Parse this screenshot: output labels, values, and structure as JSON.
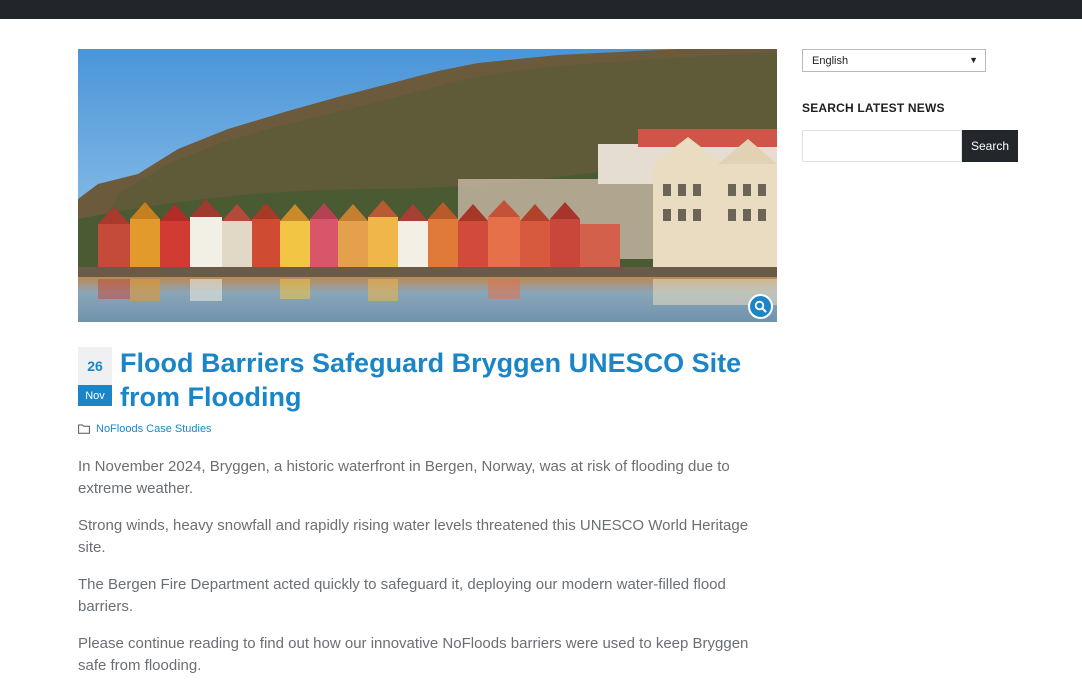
{
  "post": {
    "day": "26",
    "month": "Nov",
    "title": "Flood Barriers Safeguard Bryggen UNESCO Site from Flooding",
    "category": "NoFloods Case Studies",
    "paragraphs": [
      "In November 2024, Bryggen, a historic waterfront in Bergen, Norway, was at risk of flooding due to extreme weather.",
      "Strong winds, heavy snowfall and rapidly rising water levels threatened this UNESCO World Heritage site.",
      "The Bergen Fire Department acted quickly to safeguard it, deploying our modern water-filled flood barriers.",
      "Please continue reading to find out how our innovative NoFloods barriers were used to keep Bryggen safe from flooding."
    ]
  },
  "sidebar": {
    "language": "English",
    "search_title": "SEARCH LATEST NEWS",
    "search_placeholder": "",
    "search_button": "Search"
  },
  "colors": {
    "accent": "#1b86c7",
    "topbar": "#22262b",
    "body_text": "#6a6f74"
  },
  "icons": {
    "zoom": "magnifier-icon",
    "category": "folder-icon",
    "language_dropdown": "chevron-down-icon"
  }
}
